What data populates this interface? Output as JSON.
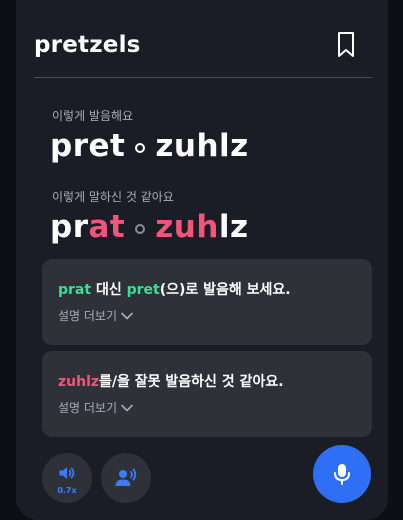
{
  "word": "pretzels",
  "correct": {
    "label": "이렇게 발음해요",
    "syllables": [
      "pret",
      "zuhlz"
    ]
  },
  "user": {
    "label": "이렇게 말하신 것 같아요",
    "syllable1": {
      "a": "pr",
      "b": "at"
    },
    "syllable2": {
      "a": "zuh",
      "b": "lz"
    }
  },
  "cards": [
    {
      "wrong": "prat",
      "mid": " 대신 ",
      "right": "pret",
      "rest": "(으)로 발음해 보세요.",
      "more": "설명 더보기"
    },
    {
      "wrong": "zuhlz",
      "rest": "를/을 잘못 발음하신 것 같아요.",
      "more": "설명 더보기"
    }
  ],
  "controls": {
    "speed": "0.7x",
    "speaker_icon": "speaker-icon",
    "voice_icon": "voice-user-icon",
    "mic_icon": "microphone-icon"
  },
  "colors": {
    "accent_blue": "#2f6ff5",
    "correct_green": "#3ddc97",
    "error_red": "#f2557a"
  }
}
